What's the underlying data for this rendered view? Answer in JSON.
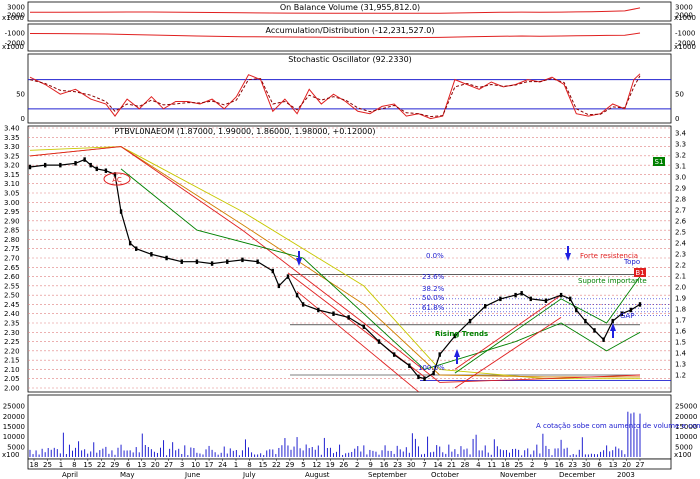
{
  "chart_data": [
    {
      "type": "line",
      "title": "On Balance Volume (31,955,812.0)",
      "scale_label": "x1000",
      "yticks": [
        2000,
        3000
      ],
      "ylim": [
        1500,
        3400
      ],
      "series": [
        {
          "color": "#e02020",
          "x": [
            0,
            10,
            25,
            40,
            55,
            70,
            85,
            100,
            115,
            125,
            135,
            145,
            155,
            162,
            168,
            175,
            180,
            185,
            190,
            196,
            201
          ],
          "values": [
            2350,
            2360,
            2380,
            2390,
            2330,
            2280,
            2250,
            2240,
            2230,
            2230,
            2240,
            2300,
            2350,
            2380,
            2360,
            2370,
            2400,
            2420,
            2460,
            2520,
            2900
          ]
        }
      ]
    },
    {
      "type": "line",
      "title": "Accumulation/Distribution (-12,231,527.0)",
      "scale_label": "x1000",
      "yticks": [
        -1000,
        -2000
      ],
      "ylim": [
        -2600,
        -400
      ],
      "series": [
        {
          "color": "#e02020",
          "x": [
            0,
            10,
            25,
            40,
            55,
            70,
            85,
            100,
            115,
            125,
            135,
            145,
            155,
            162,
            168,
            175,
            180,
            185,
            190,
            196,
            201
          ],
          "values": [
            -1050,
            -1060,
            -1100,
            -1200,
            -1300,
            -1370,
            -1400,
            -1430,
            -1450,
            -1460,
            -1440,
            -1380,
            -1330,
            -1300,
            -1320,
            -1300,
            -1280,
            -1260,
            -1240,
            -1220,
            -1000
          ]
        }
      ]
    },
    {
      "type": "line",
      "title": "Stochastic Oscillator (92.2330)",
      "yticks": [
        0,
        50
      ],
      "ylim": [
        -5,
        110
      ],
      "hlines": [
        {
          "value": 80,
          "color": "#2020d0"
        },
        {
          "value": 20,
          "color": "#2020d0"
        }
      ],
      "series": [
        {
          "color": "#e02020",
          "x": [
            0,
            5,
            10,
            15,
            20,
            25,
            28,
            32,
            36,
            40,
            44,
            48,
            52,
            56,
            60,
            64,
            68,
            72,
            76,
            80,
            84,
            88,
            92,
            96,
            100,
            104,
            108,
            112,
            116,
            120,
            124,
            128,
            132,
            136,
            140,
            144,
            148,
            152,
            156,
            160,
            164,
            168,
            172,
            176,
            180,
            184,
            188,
            192,
            196,
            199,
            201
          ],
          "values": [
            85,
            70,
            50,
            60,
            40,
            30,
            5,
            40,
            20,
            45,
            20,
            35,
            35,
            30,
            40,
            20,
            45,
            90,
            80,
            15,
            40,
            10,
            60,
            30,
            50,
            35,
            15,
            10,
            25,
            30,
            5,
            10,
            0,
            5,
            80,
            70,
            60,
            75,
            65,
            70,
            80,
            75,
            85,
            70,
            10,
            5,
            10,
            30,
            20,
            80,
            92
          ]
        },
        {
          "color": "#8a0000",
          "dash": true,
          "x": [
            0,
            5,
            10,
            15,
            20,
            25,
            28,
            32,
            36,
            40,
            44,
            48,
            52,
            56,
            60,
            64,
            68,
            72,
            76,
            80,
            84,
            88,
            92,
            96,
            100,
            104,
            108,
            112,
            116,
            120,
            124,
            128,
            132,
            136,
            140,
            144,
            148,
            152,
            156,
            160,
            164,
            168,
            172,
            176,
            180,
            184,
            188,
            192,
            196,
            199,
            201
          ],
          "values": [
            80,
            72,
            58,
            55,
            48,
            35,
            15,
            30,
            25,
            38,
            28,
            30,
            33,
            32,
            36,
            28,
            38,
            80,
            82,
            30,
            35,
            18,
            48,
            38,
            45,
            38,
            22,
            14,
            20,
            27,
            12,
            10,
            4,
            6,
            65,
            72,
            64,
            70,
            66,
            69,
            76,
            76,
            82,
            74,
            20,
            8,
            9,
            24,
            22,
            65,
            88
          ]
        }
      ]
    },
    {
      "type": "line",
      "title": "PTBVL0NAEOM (1.87000, 1.99000, 1.86000, 1.98000, +0.12000)",
      "left_ticks": [
        "2.00",
        "2.05",
        "2.10",
        "2.15",
        "2.20",
        "2.25",
        "2.30",
        "2.35",
        "2.40",
        "2.45",
        "2.50",
        "2.55",
        "2.60",
        "2.65",
        "2.70",
        "2.75",
        "2.80",
        "2.85",
        "2.90",
        "2.95",
        "3.00",
        "3.05",
        "3.10",
        "3.15",
        "3.20",
        "3.25",
        "3.30",
        "3.35",
        "3.40"
      ],
      "right_ticks": [
        "1.2",
        "1.3",
        "1.4",
        "1.5",
        "1.6",
        "1.7",
        "1.8",
        "1.9",
        "2.0",
        "2.1",
        "2.2",
        "2.3",
        "2.4",
        "2.5",
        "2.6",
        "2.7",
        "2.8",
        "2.9",
        "3.0",
        "3.1",
        "3.2",
        "3.3",
        "3.4"
      ],
      "ylim": [
        2.0,
        3.4
      ],
      "series": [
        {
          "name": "price",
          "color": "#000000",
          "x": [
            0,
            5,
            10,
            15,
            18,
            20,
            22,
            25,
            28,
            30,
            33,
            35,
            40,
            45,
            50,
            55,
            60,
            65,
            70,
            75,
            80,
            82,
            85,
            88,
            90,
            95,
            100,
            105,
            110,
            115,
            120,
            125,
            128,
            130,
            133,
            135,
            140,
            145,
            150,
            155,
            160,
            162,
            165,
            170,
            175,
            178,
            180,
            183,
            186,
            189,
            192,
            195,
            198,
            201
          ],
          "values": [
            3.19,
            3.2,
            3.2,
            3.21,
            3.23,
            3.2,
            3.18,
            3.17,
            3.15,
            2.95,
            2.78,
            2.75,
            2.72,
            2.7,
            2.68,
            2.68,
            2.67,
            2.68,
            2.69,
            2.68,
            2.63,
            2.55,
            2.6,
            2.5,
            2.45,
            2.42,
            2.4,
            2.38,
            2.33,
            2.25,
            2.18,
            2.12,
            2.06,
            2.05,
            2.08,
            2.18,
            2.28,
            2.36,
            2.44,
            2.48,
            2.5,
            2.51,
            2.48,
            2.47,
            2.5,
            2.48,
            2.42,
            2.36,
            2.31,
            2.26,
            2.36,
            2.4,
            2.42,
            2.45
          ]
        }
      ],
      "annotations": [
        "AC",
        "0.0%",
        "23.6%",
        "38.2%",
        "50.0%",
        "61.8%",
        "100.0%",
        "Rising Trends",
        "Forte resistencia",
        "Suporte importante",
        "Topo",
        "B1",
        "GAP",
        "S1"
      ]
    },
    {
      "type": "bar",
      "scale_label": "x100",
      "yticks": [
        5000,
        10000,
        15000,
        20000,
        25000
      ],
      "ylim": [
        0,
        29000
      ],
      "note": "A cotação sobe com aumento de volume e com diminuição do volume",
      "x_dates": [
        "18",
        "25",
        "1",
        "8",
        "15",
        "22",
        "29",
        "6",
        "13",
        "20",
        "27",
        "3",
        "10",
        "17",
        "24",
        "1",
        "8",
        "15",
        "22",
        "29",
        "5",
        "12",
        "19",
        "26",
        "2",
        "9",
        "16",
        "23",
        "30",
        "7",
        "14",
        "21",
        "28",
        "4",
        "11",
        "18",
        "25",
        "2",
        "9",
        "16",
        "23",
        "30",
        "6",
        "13",
        "20",
        "27"
      ],
      "x_months": [
        "April",
        "May",
        "June",
        "July",
        "August",
        "September",
        "October",
        "November",
        "December",
        "2003"
      ]
    }
  ]
}
